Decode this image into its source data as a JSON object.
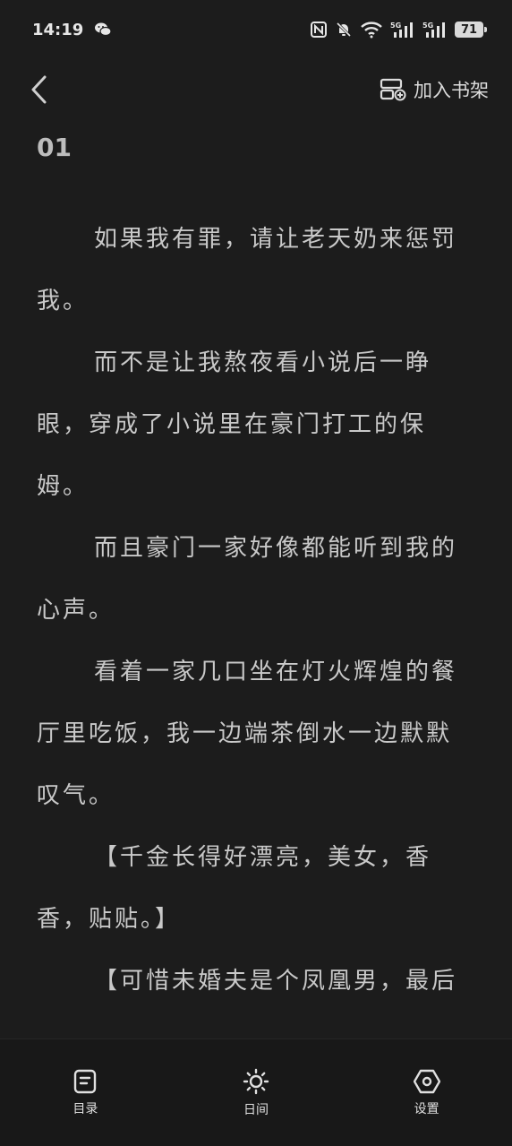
{
  "status_bar": {
    "time": "14:19",
    "battery": "71",
    "icons": [
      "wechat-icon",
      "nfc-icon",
      "mute-bell-icon",
      "wifi-icon",
      "signal-5g-icon",
      "signal-5g-icon-2"
    ]
  },
  "nav": {
    "back_icon": "chevron-left-icon",
    "add_to_shelf": "加入书架"
  },
  "chapter": {
    "title": "01",
    "paragraphs": [
      "如果我有罪，请让老天奶来惩罚我。",
      "而不是让我熬夜看小说后一睁眼，穿成了小说里在豪门打工的保姆。",
      "而且豪门一家好像都能听到我的心声。",
      "看着一家几口坐在灯火辉煌的餐厅里吃饭，我一边端茶倒水一边默默叹气。",
      "【千金长得好漂亮，美女，香香，贴贴。】",
      "【可惜未婚夫是个凤凰男，最后"
    ]
  },
  "bottom_tabs": [
    {
      "label": "目录",
      "icon": "catalog-icon"
    },
    {
      "label": "日间",
      "icon": "sun-icon"
    },
    {
      "label": "设置",
      "icon": "settings-icon"
    }
  ]
}
